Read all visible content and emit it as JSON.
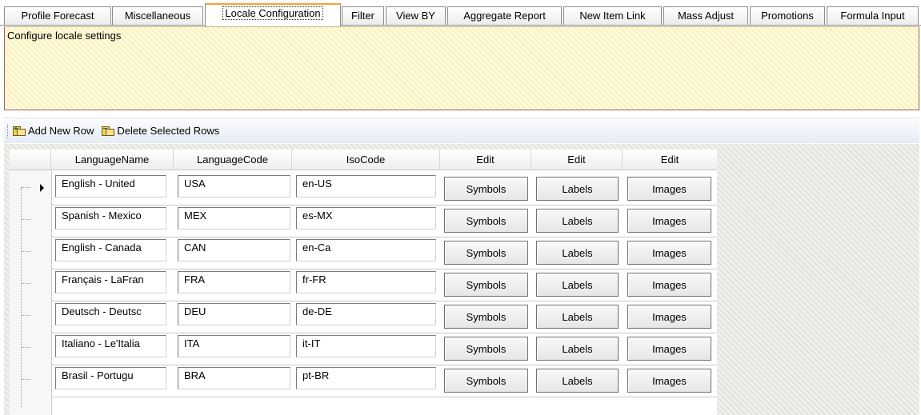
{
  "tabs": [
    {
      "label": "Profile Forecast",
      "active": false
    },
    {
      "label": "Miscellaneous",
      "active": false
    },
    {
      "label": "Locale Configuration",
      "active": true
    },
    {
      "label": "Filter",
      "active": false
    },
    {
      "label": "View BY",
      "active": false
    },
    {
      "label": "Aggregate Report",
      "active": false
    },
    {
      "label": "New Item Link",
      "active": false
    },
    {
      "label": "Mass Adjust",
      "active": false
    },
    {
      "label": "Promotions",
      "active": false
    },
    {
      "label": "Formula Input",
      "active": false
    }
  ],
  "description": "Configure locale settings",
  "toolbar": {
    "add_label": "Add New Row",
    "delete_label": "Delete Selected Rows",
    "add_icon": "add-row-icon",
    "delete_icon": "delete-rows-icon"
  },
  "grid": {
    "columns": [
      "LanguageName",
      "LanguageCode",
      "IsoCode",
      "Edit",
      "Edit",
      "Edit"
    ],
    "rows": [
      {
        "name": "English - United",
        "code": "USA",
        "iso": "en-US",
        "selected": true
      },
      {
        "name": "Spanish - Mexico",
        "code": "MEX",
        "iso": "es-MX",
        "selected": false
      },
      {
        "name": "English - Canada",
        "code": "CAN",
        "iso": "en-Ca",
        "selected": false
      },
      {
        "name": "Français - LaFran",
        "code": "FRA",
        "iso": "fr-FR",
        "selected": false
      },
      {
        "name": "Deutsch - Deutsc",
        "code": "DEU",
        "iso": "de-DE",
        "selected": false
      },
      {
        "name": "Italiano - Le'Italia",
        "code": "ITA",
        "iso": "it-IT",
        "selected": false
      },
      {
        "name": "Brasil - Portugu",
        "code": "BRA",
        "iso": "pt-BR",
        "selected": false
      }
    ],
    "button_labels": {
      "symbols": "Symbols",
      "labels": "Labels",
      "images": "Images"
    }
  }
}
